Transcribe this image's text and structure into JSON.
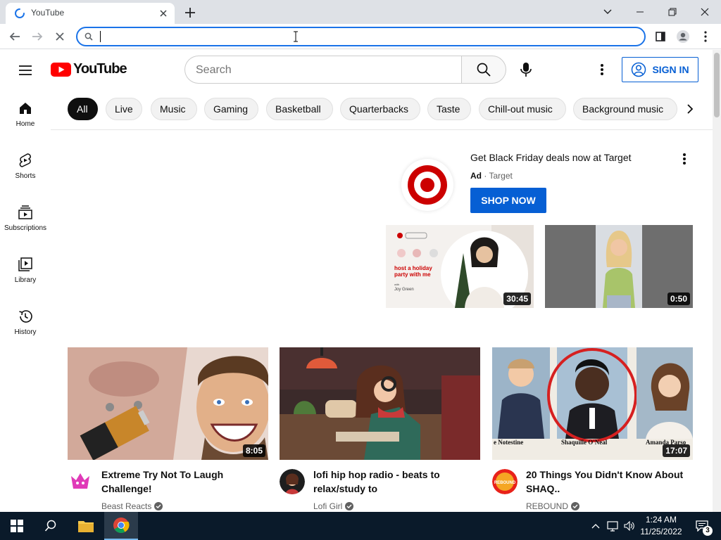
{
  "browser": {
    "tab_title": "YouTube",
    "omnibox_value": "",
    "colors": {
      "accent": "#1a73e8",
      "titlebar": "#dee1e6"
    }
  },
  "youtube": {
    "logo_text": "YouTube",
    "search_placeholder": "Search",
    "signin_label": "SIGN IN",
    "colors": {
      "brand_red": "#ff0000",
      "link_blue": "#065fd4"
    },
    "chips": [
      "All",
      "Live",
      "Music",
      "Gaming",
      "Basketball",
      "Quarterbacks",
      "Taste",
      "Chill-out music",
      "Background music"
    ],
    "guide": [
      {
        "label": "Home",
        "icon": "home-icon"
      },
      {
        "label": "Shorts",
        "icon": "shorts-icon"
      },
      {
        "label": "Subscriptions",
        "icon": "subscriptions-icon"
      },
      {
        "label": "Library",
        "icon": "library-icon"
      },
      {
        "label": "History",
        "icon": "history-icon"
      }
    ],
    "ad": {
      "title": "Get Black Friday deals now at Target",
      "badge": "Ad",
      "separator": "·",
      "advertiser": "Target",
      "cta": "SHOP NOW",
      "thumb1": {
        "duration": "30:45",
        "headline": "host a holiday party with me",
        "with_label": "with",
        "host_name": "Joy Green"
      },
      "thumb2": {
        "duration": "0:50"
      }
    },
    "videos": [
      {
        "title": "Extreme Try Not To Laugh Challenge!",
        "channel": "Beast Reacts",
        "duration": "8:05",
        "verified": true
      },
      {
        "title": "lofi hip hop radio - beats to relax/study to",
        "channel": "Lofi Girl",
        "duration": "",
        "verified": true
      },
      {
        "title": "20 Things You Didn't Know About SHAQ..",
        "channel": "REBOUND",
        "duration": "17:07",
        "verified": true,
        "thumb_captions": [
          "e Notestine",
          "Shaquille O'Neal",
          "Amanda Parso"
        ],
        "avatar_text": "REBOUND"
      }
    ]
  },
  "taskbar": {
    "time": "1:24 AM",
    "date": "11/25/2022",
    "notification_count": "3"
  }
}
